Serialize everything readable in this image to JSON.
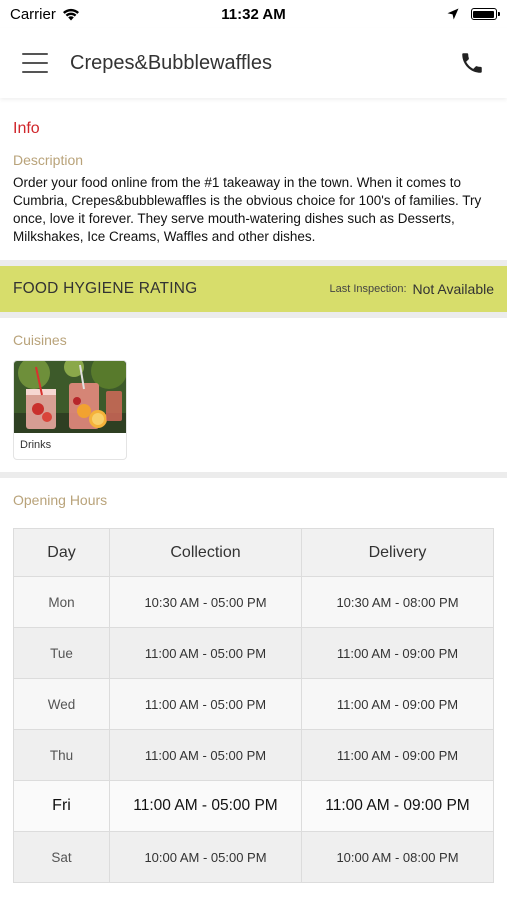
{
  "status_bar": {
    "carrier": "Carrier",
    "time": "11:32 AM"
  },
  "header": {
    "title": "Crepes&Bubblewaffles"
  },
  "info": {
    "heading": "Info",
    "description_label": "Description",
    "description_text": "Order your food online from the #1 takeaway in the town. When it comes to Cumbria, Crepes&bubblewaffles is the obvious choice for 100's of families. Try once, love it forever. They serve mouth-watering dishes such as Desserts, Milkshakes, Ice Creams, Waffles and other dishes."
  },
  "hygiene": {
    "title": "FOOD HYGIENE RATING",
    "last_inspection_label": "Last Inspection:",
    "last_inspection_value": "Not Available"
  },
  "cuisines": {
    "label": "Cuisines",
    "items": [
      {
        "name": "Drinks"
      }
    ]
  },
  "opening_hours": {
    "label": "Opening Hours",
    "headers": {
      "day": "Day",
      "collection": "Collection",
      "delivery": "Delivery"
    },
    "rows": [
      {
        "day": "Mon",
        "collection": "10:30 AM - 05:00 PM",
        "delivery": "10:30 AM - 08:00 PM"
      },
      {
        "day": "Tue",
        "collection": "11:00 AM - 05:00 PM",
        "delivery": "11:00 AM - 09:00 PM"
      },
      {
        "day": "Wed",
        "collection": "11:00 AM - 05:00 PM",
        "delivery": "11:00 AM - 09:00 PM"
      },
      {
        "day": "Thu",
        "collection": "11:00 AM - 05:00 PM",
        "delivery": "11:00 AM - 09:00 PM"
      },
      {
        "day": "Fri",
        "collection": "11:00 AM - 05:00 PM",
        "delivery": "11:00 AM - 09:00 PM"
      },
      {
        "day": "Sat",
        "collection": "10:00 AM - 05:00 PM",
        "delivery": "10:00 AM - 08:00 PM"
      }
    ]
  },
  "icons": {
    "menu": "hamburger-menu-icon",
    "phone": "phone-icon",
    "wifi": "wifi-icon",
    "location": "location-arrow-icon",
    "battery": "battery-icon"
  },
  "colors": {
    "info_heading": "#d0262b",
    "label_gold": "#b9a37a",
    "hygiene_bar": "#d7dd6b"
  }
}
